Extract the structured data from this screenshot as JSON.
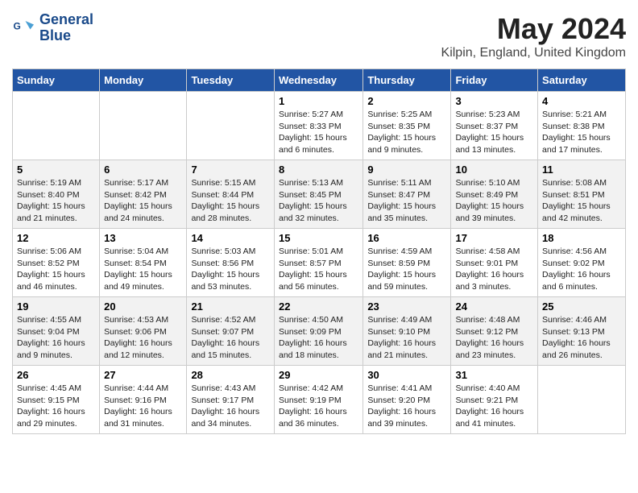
{
  "header": {
    "logo_line1": "General",
    "logo_line2": "Blue",
    "month_title": "May 2024",
    "location": "Kilpin, England, United Kingdom"
  },
  "days_of_week": [
    "Sunday",
    "Monday",
    "Tuesday",
    "Wednesday",
    "Thursday",
    "Friday",
    "Saturday"
  ],
  "weeks": [
    [
      {
        "day": "",
        "info": ""
      },
      {
        "day": "",
        "info": ""
      },
      {
        "day": "",
        "info": ""
      },
      {
        "day": "1",
        "info": "Sunrise: 5:27 AM\nSunset: 8:33 PM\nDaylight: 15 hours\nand 6 minutes."
      },
      {
        "day": "2",
        "info": "Sunrise: 5:25 AM\nSunset: 8:35 PM\nDaylight: 15 hours\nand 9 minutes."
      },
      {
        "day": "3",
        "info": "Sunrise: 5:23 AM\nSunset: 8:37 PM\nDaylight: 15 hours\nand 13 minutes."
      },
      {
        "day": "4",
        "info": "Sunrise: 5:21 AM\nSunset: 8:38 PM\nDaylight: 15 hours\nand 17 minutes."
      }
    ],
    [
      {
        "day": "5",
        "info": "Sunrise: 5:19 AM\nSunset: 8:40 PM\nDaylight: 15 hours\nand 21 minutes."
      },
      {
        "day": "6",
        "info": "Sunrise: 5:17 AM\nSunset: 8:42 PM\nDaylight: 15 hours\nand 24 minutes."
      },
      {
        "day": "7",
        "info": "Sunrise: 5:15 AM\nSunset: 8:44 PM\nDaylight: 15 hours\nand 28 minutes."
      },
      {
        "day": "8",
        "info": "Sunrise: 5:13 AM\nSunset: 8:45 PM\nDaylight: 15 hours\nand 32 minutes."
      },
      {
        "day": "9",
        "info": "Sunrise: 5:11 AM\nSunset: 8:47 PM\nDaylight: 15 hours\nand 35 minutes."
      },
      {
        "day": "10",
        "info": "Sunrise: 5:10 AM\nSunset: 8:49 PM\nDaylight: 15 hours\nand 39 minutes."
      },
      {
        "day": "11",
        "info": "Sunrise: 5:08 AM\nSunset: 8:51 PM\nDaylight: 15 hours\nand 42 minutes."
      }
    ],
    [
      {
        "day": "12",
        "info": "Sunrise: 5:06 AM\nSunset: 8:52 PM\nDaylight: 15 hours\nand 46 minutes."
      },
      {
        "day": "13",
        "info": "Sunrise: 5:04 AM\nSunset: 8:54 PM\nDaylight: 15 hours\nand 49 minutes."
      },
      {
        "day": "14",
        "info": "Sunrise: 5:03 AM\nSunset: 8:56 PM\nDaylight: 15 hours\nand 53 minutes."
      },
      {
        "day": "15",
        "info": "Sunrise: 5:01 AM\nSunset: 8:57 PM\nDaylight: 15 hours\nand 56 minutes."
      },
      {
        "day": "16",
        "info": "Sunrise: 4:59 AM\nSunset: 8:59 PM\nDaylight: 15 hours\nand 59 minutes."
      },
      {
        "day": "17",
        "info": "Sunrise: 4:58 AM\nSunset: 9:01 PM\nDaylight: 16 hours\nand 3 minutes."
      },
      {
        "day": "18",
        "info": "Sunrise: 4:56 AM\nSunset: 9:02 PM\nDaylight: 16 hours\nand 6 minutes."
      }
    ],
    [
      {
        "day": "19",
        "info": "Sunrise: 4:55 AM\nSunset: 9:04 PM\nDaylight: 16 hours\nand 9 minutes."
      },
      {
        "day": "20",
        "info": "Sunrise: 4:53 AM\nSunset: 9:06 PM\nDaylight: 16 hours\nand 12 minutes."
      },
      {
        "day": "21",
        "info": "Sunrise: 4:52 AM\nSunset: 9:07 PM\nDaylight: 16 hours\nand 15 minutes."
      },
      {
        "day": "22",
        "info": "Sunrise: 4:50 AM\nSunset: 9:09 PM\nDaylight: 16 hours\nand 18 minutes."
      },
      {
        "day": "23",
        "info": "Sunrise: 4:49 AM\nSunset: 9:10 PM\nDaylight: 16 hours\nand 21 minutes."
      },
      {
        "day": "24",
        "info": "Sunrise: 4:48 AM\nSunset: 9:12 PM\nDaylight: 16 hours\nand 23 minutes."
      },
      {
        "day": "25",
        "info": "Sunrise: 4:46 AM\nSunset: 9:13 PM\nDaylight: 16 hours\nand 26 minutes."
      }
    ],
    [
      {
        "day": "26",
        "info": "Sunrise: 4:45 AM\nSunset: 9:15 PM\nDaylight: 16 hours\nand 29 minutes."
      },
      {
        "day": "27",
        "info": "Sunrise: 4:44 AM\nSunset: 9:16 PM\nDaylight: 16 hours\nand 31 minutes."
      },
      {
        "day": "28",
        "info": "Sunrise: 4:43 AM\nSunset: 9:17 PM\nDaylight: 16 hours\nand 34 minutes."
      },
      {
        "day": "29",
        "info": "Sunrise: 4:42 AM\nSunset: 9:19 PM\nDaylight: 16 hours\nand 36 minutes."
      },
      {
        "day": "30",
        "info": "Sunrise: 4:41 AM\nSunset: 9:20 PM\nDaylight: 16 hours\nand 39 minutes."
      },
      {
        "day": "31",
        "info": "Sunrise: 4:40 AM\nSunset: 9:21 PM\nDaylight: 16 hours\nand 41 minutes."
      },
      {
        "day": "",
        "info": ""
      }
    ]
  ]
}
